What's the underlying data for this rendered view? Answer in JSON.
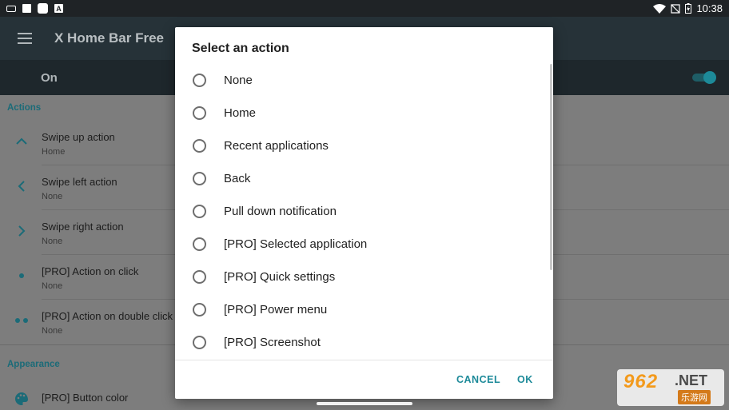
{
  "status_bar": {
    "time": "10:38"
  },
  "app_bar": {
    "title": "X Home Bar Free"
  },
  "master_switch": {
    "label": "On",
    "enabled": true
  },
  "settings": {
    "sections": [
      {
        "header": "Actions",
        "items": [
          {
            "title": "Swipe up action",
            "value": "Home",
            "icon": "chevron-up-icon"
          },
          {
            "title": "Swipe left action",
            "value": "None",
            "icon": "chevron-left-icon"
          },
          {
            "title": "Swipe right action",
            "value": "None",
            "icon": "chevron-right-icon"
          },
          {
            "title": "[PRO] Action on click",
            "value": "None",
            "icon": "single-dot-icon"
          },
          {
            "title": "[PRO] Action on double click",
            "value": "None",
            "icon": "double-dot-icon"
          }
        ]
      },
      {
        "header": "Appearance",
        "items": [
          {
            "title": "[PRO] Button color",
            "icon": "palette-icon"
          }
        ]
      }
    ]
  },
  "dialog": {
    "title": "Select an action",
    "options": [
      "None",
      "Home",
      "Recent applications",
      "Back",
      "Pull down notification",
      "[PRO] Selected application",
      "[PRO] Quick settings",
      "[PRO] Power menu",
      "[PRO] Screenshot"
    ],
    "cancel_label": "CANCEL",
    "ok_label": "OK"
  },
  "watermark": {
    "number": "962",
    "suffix": ".NET",
    "chinese": "乐游网"
  },
  "colors": {
    "accent": "#1d8a99",
    "app_bar": "#263238",
    "status_bar": "#1f2326",
    "section_header": "#1b6b78"
  }
}
